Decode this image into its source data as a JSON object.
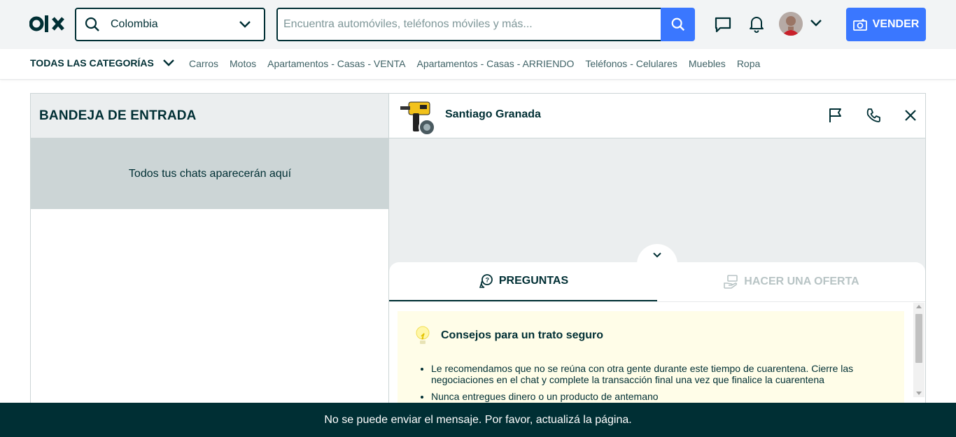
{
  "header": {
    "location": {
      "value": "Colombia"
    },
    "search": {
      "placeholder": "Encuentra automóviles, teléfonos móviles y más..."
    },
    "sell_label": "VENDER"
  },
  "categories": {
    "all_label": "TODAS LAS CATEGORÍAS",
    "links": [
      "Carros",
      "Motos",
      "Apartamentos - Casas - VENTA",
      "Apartamentos - Casas - ARRIENDO",
      "Teléfonos - Celulares",
      "Muebles",
      "Ropa"
    ]
  },
  "inbox": {
    "title": "BANDEJA DE ENTRADA",
    "empty_message": "Todos tus chats aparecerán aquí"
  },
  "chat": {
    "user_name": "Santiago Granada",
    "tabs": [
      {
        "label": "PREGUNTAS",
        "active": true
      },
      {
        "label": "HACER UNA OFERTA",
        "active": false
      }
    ],
    "tips": {
      "title": "Consejos para un trato seguro",
      "items": [
        "Le recomendamos que no se reúna con otra gente durante este tiempo de cuarentena. Cierre las negociaciones en el chat y complete la transacción final una vez que finalice la cuarentena",
        "Nunca entregues dinero o un producto de antemano"
      ]
    }
  },
  "toast": {
    "message": "No se puede enviar el mensaje. Por favor, actualizá la página."
  },
  "colors": {
    "brand_dark": "#002f34",
    "accent_blue": "#3a77ff",
    "tips_bg": "#fffde8"
  }
}
